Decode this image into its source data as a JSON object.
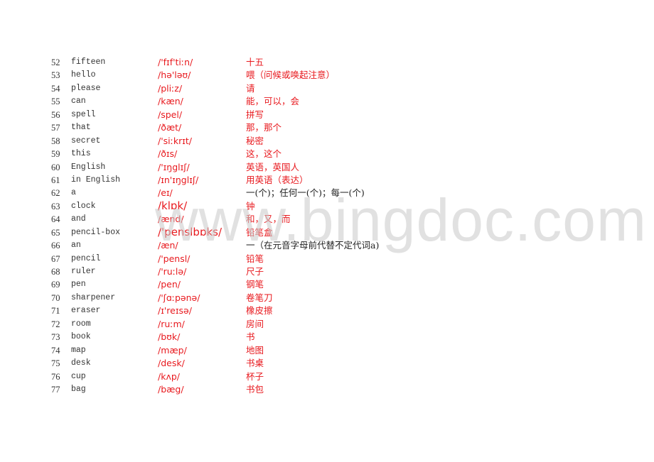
{
  "colors": {
    "phonetic": "#e8191e",
    "meaning_red": "#e8191e",
    "meaning_black": "#222222",
    "text": "#333333",
    "watermark": "#c8c8c8"
  },
  "watermark": "www.bingdoc.com",
  "vocabulary": [
    {
      "num": "52",
      "word": "fifteen",
      "phonetic": "/'fɪf'tiːn/",
      "meaning": "十五"
    },
    {
      "num": "53",
      "word": "hello",
      "phonetic": "/hə'ləʊ/",
      "meaning": "喂（问候或唤起注意）"
    },
    {
      "num": "54",
      "word": "please",
      "phonetic": "/pliːz/",
      "meaning": "请"
    },
    {
      "num": "55",
      "word": "can",
      "phonetic": "/kæn/",
      "meaning": "能，可以，会"
    },
    {
      "num": "56",
      "word": "spell",
      "phonetic": "/spel/",
      "meaning": "拼写"
    },
    {
      "num": "57",
      "word": "that",
      "phonetic": "/ðæt/",
      "meaning": "那，那个"
    },
    {
      "num": "58",
      "word": "secret",
      "phonetic": "/'siːkrɪt/",
      "meaning": "秘密"
    },
    {
      "num": "59",
      "word": "this",
      "phonetic": "/ðɪs/",
      "meaning": "这，这个"
    },
    {
      "num": "60",
      "word": "English",
      "phonetic": "/'ɪŋglɪʃ/",
      "meaning": "英语，英国人"
    },
    {
      "num": "61",
      "word": "in English",
      "phonetic": "/ɪn'ɪŋglɪʃ/",
      "meaning": "用英语（表达）"
    },
    {
      "num": "62",
      "word": "a",
      "phonetic": "/eɪ/",
      "meaning": "一(个)；任何一(个)；每一(个)"
    },
    {
      "num": "63",
      "word": "clock",
      "phonetic": "/klɒk/",
      "meaning": "钟"
    },
    {
      "num": "64",
      "word": "and",
      "phonetic": "/ænd/",
      "meaning": "和，又，而"
    },
    {
      "num": "65",
      "word": "pencil-box",
      "phonetic": "/'penslbɒks/",
      "meaning": "铅笔盒"
    },
    {
      "num": "66",
      "word": "an",
      "phonetic": "/æn/",
      "meaning": "一（在元音字母前代替不定代词a)"
    },
    {
      "num": "67",
      "word": "pencil",
      "phonetic": "/'pensl/",
      "meaning": "铅笔"
    },
    {
      "num": "68",
      "word": "ruler",
      "phonetic": "/'ruːlə/",
      "meaning": "尺子"
    },
    {
      "num": "69",
      "word": "pen",
      "phonetic": "/pen/",
      "meaning": "钢笔"
    },
    {
      "num": "70",
      "word": "sharpener",
      "phonetic": "/'ʃɑːpənə/",
      "meaning": "卷笔刀"
    },
    {
      "num": "71",
      "word": "eraser",
      "phonetic": "/ɪ'reɪsə/",
      "meaning": "橡皮擦"
    },
    {
      "num": "72",
      "word": "room",
      "phonetic": "/ruːm/",
      "meaning": "房间"
    },
    {
      "num": "73",
      "word": "book",
      "phonetic": "/bʊk/",
      "meaning": "书"
    },
    {
      "num": "74",
      "word": "map",
      "phonetic": "/mæp/",
      "meaning": "地图"
    },
    {
      "num": "75",
      "word": "desk",
      "phonetic": "/desk/",
      "meaning": "书桌"
    },
    {
      "num": "76",
      "word": "cup",
      "phonetic": "/kʌp/",
      "meaning": "杯子"
    },
    {
      "num": "77",
      "word": "bag",
      "phonetic": "/bæg/",
      "meaning": "书包"
    }
  ]
}
